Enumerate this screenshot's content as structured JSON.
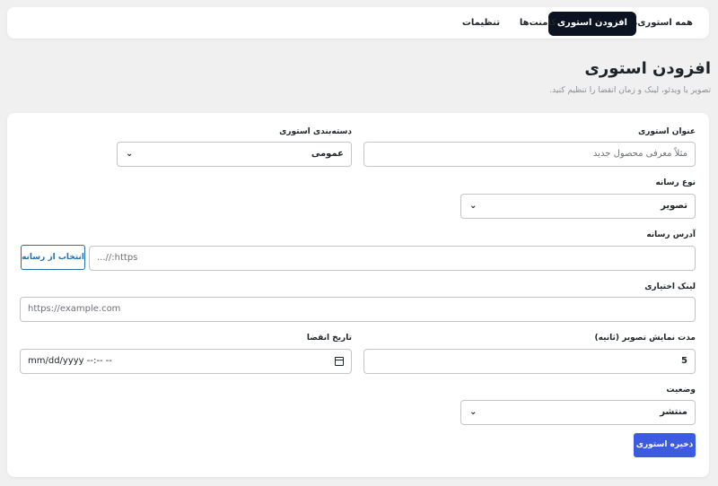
{
  "tabs": [
    {
      "label": "همه استوری‌ها",
      "active": false
    },
    {
      "label": "افزودن استوری",
      "active": true
    },
    {
      "label": "کامنت‌ها",
      "active": false
    },
    {
      "label": "تنظیمات",
      "active": false
    }
  ],
  "header": {
    "title": "افزودن استوری",
    "subtitle": "تصویر یا ویدئو، لینک و زمان انقضا را تنظیم کنید."
  },
  "form": {
    "story_title": {
      "label": "عنوان استوری",
      "placeholder": "مثلاً معرفی محصول جدید"
    },
    "category": {
      "label": "دسته‌بندی استوری",
      "value": "عمومی"
    },
    "media_type": {
      "label": "نوع رسانه",
      "value": "تصویر"
    },
    "media_url": {
      "label": "آدرس رسانه",
      "placeholder": "...//:https",
      "button": "انتخاب از رسانه"
    },
    "link": {
      "label": "لینک اختیاری",
      "placeholder": "https://example.com"
    },
    "duration": {
      "label": "مدت نمایش تصویر (ثانیه)",
      "value": "5"
    },
    "expiry": {
      "label": "تاریخ انقضا",
      "placeholder": "mm/dd/yyyy --:-- --"
    },
    "status": {
      "label": "وضعیت",
      "value": "منتشر"
    },
    "save_label": "ذخیره استوری"
  },
  "colors": {
    "active_tab": "#0b1221",
    "primary": "#3d5be0",
    "outline": "#2271b1"
  }
}
